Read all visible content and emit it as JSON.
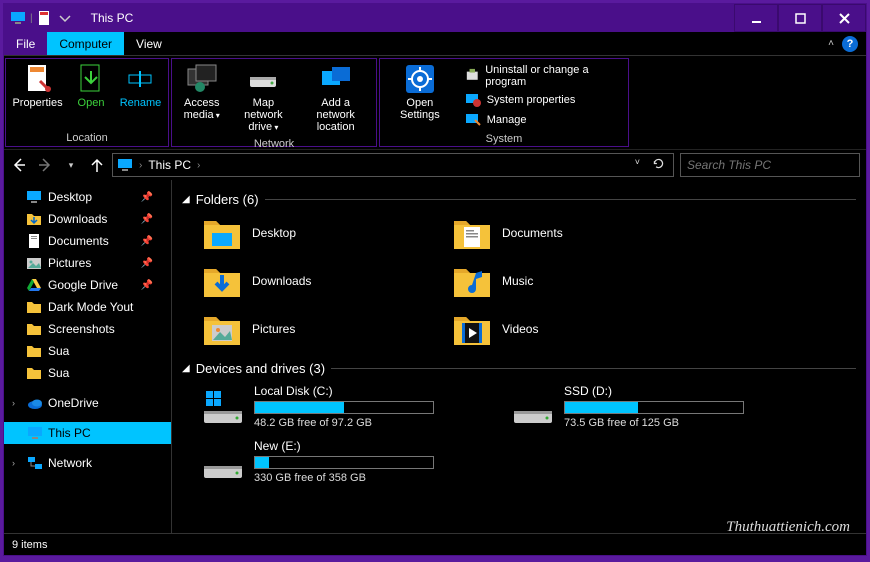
{
  "title": "This PC",
  "tabs": {
    "file": "File",
    "computer": "Computer",
    "view": "View"
  },
  "ribbon": {
    "location": {
      "label": "Location",
      "properties": "Properties",
      "open": "Open",
      "rename": "Rename"
    },
    "network": {
      "label": "Network",
      "access_media": "Access media",
      "map_drive": "Map network drive",
      "add_location": "Add a network location"
    },
    "system": {
      "label": "System",
      "open_settings": "Open Settings",
      "uninstall": "Uninstall or change a program",
      "sys_props": "System properties",
      "manage": "Manage"
    }
  },
  "breadcrumb": "This PC",
  "search_placeholder": "Search This PC",
  "sidebar": {
    "quick": [
      {
        "label": "Desktop",
        "pinned": true
      },
      {
        "label": "Downloads",
        "pinned": true
      },
      {
        "label": "Documents",
        "pinned": true
      },
      {
        "label": "Pictures",
        "pinned": true
      },
      {
        "label": "Google Drive",
        "pinned": true
      },
      {
        "label": "Dark Mode Yout",
        "pinned": false
      },
      {
        "label": "Screenshots",
        "pinned": false
      },
      {
        "label": "Sua",
        "pinned": false
      },
      {
        "label": "Sua",
        "pinned": false
      }
    ],
    "onedrive": "OneDrive",
    "thispc": "This PC",
    "network": "Network"
  },
  "sections": {
    "folders_label": "Folders (6)",
    "drives_label": "Devices and drives (3)"
  },
  "folders": [
    {
      "name": "Desktop"
    },
    {
      "name": "Documents"
    },
    {
      "name": "Downloads"
    },
    {
      "name": "Music"
    },
    {
      "name": "Pictures"
    },
    {
      "name": "Videos"
    }
  ],
  "drives": [
    {
      "name": "Local Disk (C:)",
      "free_text": "48.2 GB free of 97.2 GB",
      "fill_pct": 50,
      "os": true
    },
    {
      "name": "SSD (D:)",
      "free_text": "73.5 GB free of 125 GB",
      "fill_pct": 41,
      "os": false
    },
    {
      "name": "New (E:)",
      "free_text": "330 GB free of 358 GB",
      "fill_pct": 8,
      "os": false
    }
  ],
  "status": "9 items",
  "watermark": "Thuthuattienich.com"
}
